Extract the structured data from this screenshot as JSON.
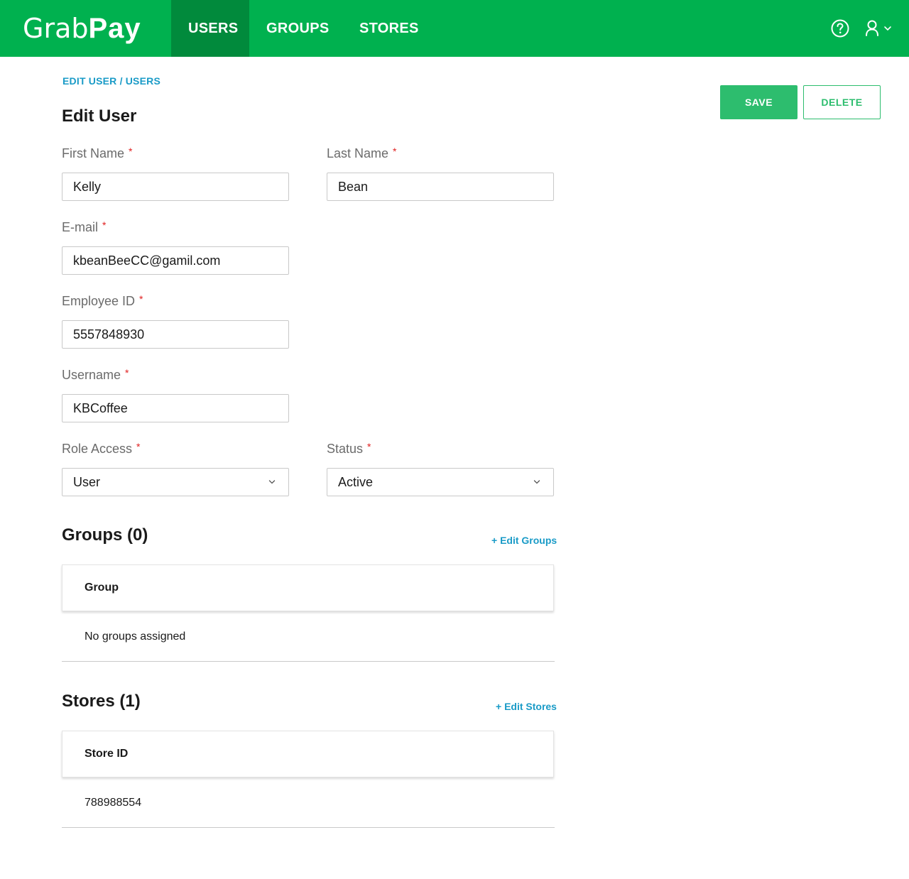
{
  "brand": {
    "logo_part1": "Grab",
    "logo_part2": "Pay",
    "color": "#00b14f"
  },
  "nav": {
    "items": [
      {
        "label": "USERS",
        "active": true
      },
      {
        "label": "GROUPS",
        "active": false
      },
      {
        "label": "STORES",
        "active": false
      }
    ]
  },
  "header_icons": [
    "help-icon",
    "user-icon",
    "chevron-down-icon"
  ],
  "breadcrumb": "EDIT USER / USERS",
  "page_title": "Edit User",
  "actions": {
    "save_label": "SAVE",
    "delete_label": "DELETE"
  },
  "form": {
    "first_name": {
      "label": "First Name",
      "required": "*",
      "value": "Kelly"
    },
    "last_name": {
      "label": "Last Name",
      "required": "*",
      "value": "Bean"
    },
    "email": {
      "label": "E-mail",
      "required": "*",
      "value": "kbeanBeeCC@gamil.com"
    },
    "employee_id": {
      "label": "Employee ID",
      "required": "*",
      "value": "5557848930"
    },
    "username": {
      "label": "Username",
      "required": "*",
      "value": "KBCoffee"
    },
    "role_access": {
      "label": "Role Access",
      "required": "*",
      "value": "User"
    },
    "status": {
      "label": "Status",
      "required": "*",
      "value": "Active"
    }
  },
  "groups": {
    "title": "Groups (0)",
    "edit_link": "+ Edit Groups",
    "column": "Group",
    "rows": [
      "No groups assigned"
    ]
  },
  "stores": {
    "title": "Stores (1)",
    "edit_link": "+ Edit Stores",
    "column": "Store ID",
    "rows": [
      "788988554"
    ]
  },
  "colors": {
    "accent": "#2dbd6e",
    "link": "#1a9bc7",
    "required": "#e02020",
    "nav_active": "#018a3c"
  }
}
